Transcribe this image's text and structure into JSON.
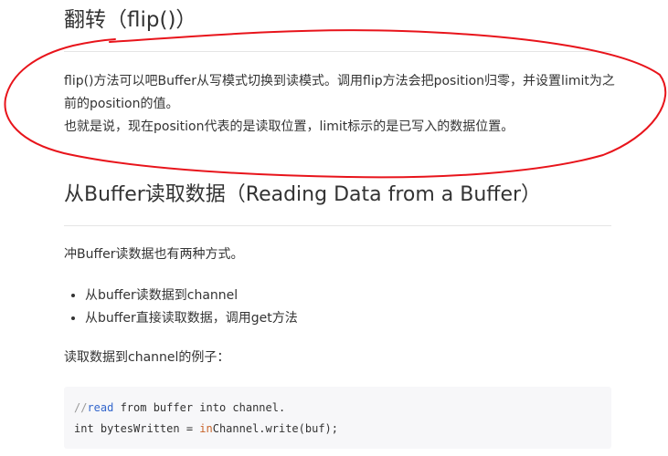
{
  "section_flip": {
    "heading": "翻转（flip()）",
    "paragraph_line1": "flip()方法可以吧Buffer从写模式切换到读模式。调用flip方法会把position归零，并设置limit为之前的position的值。",
    "paragraph_line2": "也就是说，现在position代表的是读取位置，limit标示的是已写入的数据位置。"
  },
  "section_read": {
    "heading": "从Buffer读取数据（Reading Data from a Buffer）",
    "intro": "冲Buffer读数据也有两种方式。",
    "bullets": [
      "从buffer读数据到channel",
      "从buffer直接读取数据，调用get方法"
    ],
    "example_caption": "读取数据到channel的例子："
  },
  "code_block": {
    "line1": {
      "comment_prefix": "//",
      "comment_keyword": "read",
      "comment_rest": " from buffer into channel."
    },
    "line2": {
      "prefix": "int bytesWritten = ",
      "highlight": "in",
      "suffix": "Channel.write(buf);"
    }
  },
  "colors": {
    "annotation_stroke": "#e8141b",
    "code_background": "#f7f7f9",
    "rule": "#e5e5e5",
    "comment": "#999999",
    "keyword": "#3366cc",
    "highlight": "#c8642a"
  }
}
